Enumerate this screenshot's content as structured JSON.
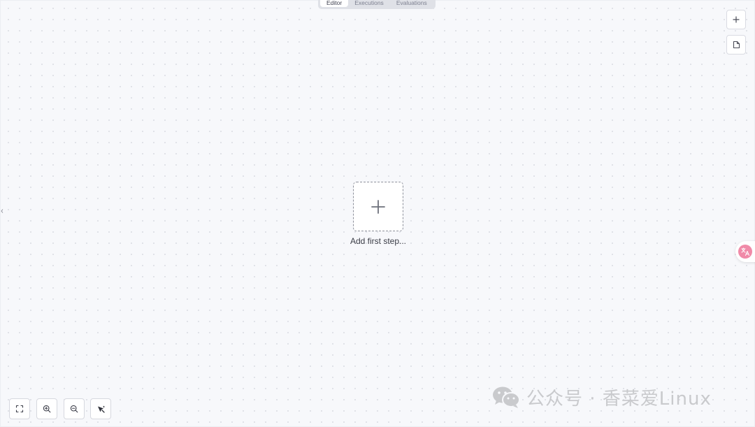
{
  "tabs": [
    {
      "label": "Editor",
      "active": true
    },
    {
      "label": "Executions",
      "active": false
    },
    {
      "label": "Evaluations",
      "active": false
    }
  ],
  "canvas": {
    "add_step_label": "Add first step...",
    "add_step_icon": "plus-icon"
  },
  "side_buttons": [
    {
      "icon": "plus-icon"
    },
    {
      "icon": "sticky-note-icon"
    }
  ],
  "zoom_controls": [
    {
      "icon": "fit-view-icon"
    },
    {
      "icon": "zoom-in-icon"
    },
    {
      "icon": "zoom-out-icon"
    },
    {
      "icon": "tidy-up-icon"
    }
  ],
  "translate_icon": "translate-icon",
  "watermark": {
    "text": "公众号 · 香菜爱Linux",
    "icon": "wechat-icon"
  },
  "colors": {
    "canvas_bg": "#f7f8fb",
    "dot": "#dcdee5",
    "accent_pink": "#f08aa8",
    "tab_bar": "#dfe1e7"
  }
}
